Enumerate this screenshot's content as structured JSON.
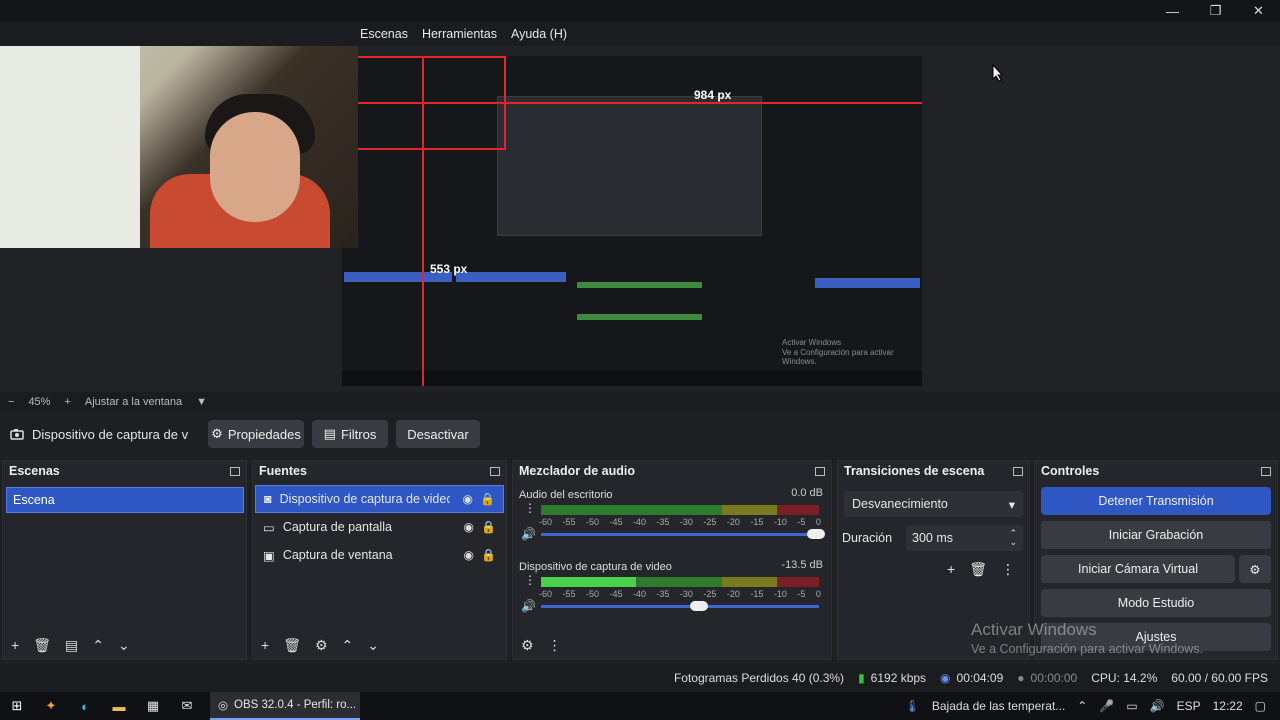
{
  "window": {
    "minimize": "—",
    "maximize": "❐",
    "close": "✕"
  },
  "menu": [
    "Escenas",
    "Herramientas",
    "Ayuda (H)"
  ],
  "preview": {
    "label_984": "984 px",
    "label_553": "553 px",
    "nested_activar_1": "Activar Windows",
    "nested_activar_2": "Ve a Configuración para activar Windows."
  },
  "zoom": {
    "minus": "−",
    "value": "45%",
    "plus": "+",
    "fit": "Ajustar a la ventana",
    "arrow": "▼"
  },
  "source_toolbar": {
    "current": "Dispositivo de captura de v",
    "properties": "Propiedades",
    "filters": "Filtros",
    "deactivate": "Desactivar"
  },
  "scenes": {
    "title": "Escenas",
    "items": [
      "Escena"
    ]
  },
  "sources": {
    "title": "Fuentes",
    "items": [
      "Dispositivo de captura de video",
      "Captura de pantalla",
      "Captura de ventana"
    ]
  },
  "mixer": {
    "title": "Mezclador de audio",
    "channels": [
      {
        "name": "Audio del escritorio",
        "db": "0.0 dB",
        "level": 0,
        "volume": 1.0
      },
      {
        "name": "Dispositivo de captura de video",
        "db": "-13.5 dB",
        "level": 0.34,
        "volume": 0.58
      }
    ],
    "ticks": [
      "-60",
      "-55",
      "-50",
      "-45",
      "-40",
      "-35",
      "-30",
      "-25",
      "-20",
      "-15",
      "-10",
      "-5",
      "0"
    ]
  },
  "transitions": {
    "title": "Transiciones de escena",
    "selected": "Desvanecimiento",
    "duration_label": "Duración",
    "duration_value": "300 ms"
  },
  "controls": {
    "title": "Controles",
    "stop_stream": "Detener Transmisión",
    "start_recording": "Iniciar Grabación",
    "start_virtual_cam": "Iniciar Cámara Virtual",
    "studio_mode": "Modo Estudio",
    "settings": "Ajustes"
  },
  "watermark": {
    "line1": "Activar Windows",
    "line2": "Ve a Configuración para activar Windows."
  },
  "status": {
    "dropped_frames": "Fotogramas Perdidos 40 (0.3%)",
    "bitrate": "6192 kbps",
    "stream_time": "00:04:09",
    "rec_time": "00:00:00",
    "cpu": "CPU: 14.2%",
    "fps": "60.00 / 60.00 FPS"
  },
  "taskbar": {
    "app_label": "OBS 32.0.4 - Perfil: ro...",
    "weather": "Bajada de las temperat...",
    "lang": "ESP",
    "time": "12:22"
  },
  "colors": {
    "accent": "#2f57c4",
    "guide_red": "#e0262a"
  }
}
